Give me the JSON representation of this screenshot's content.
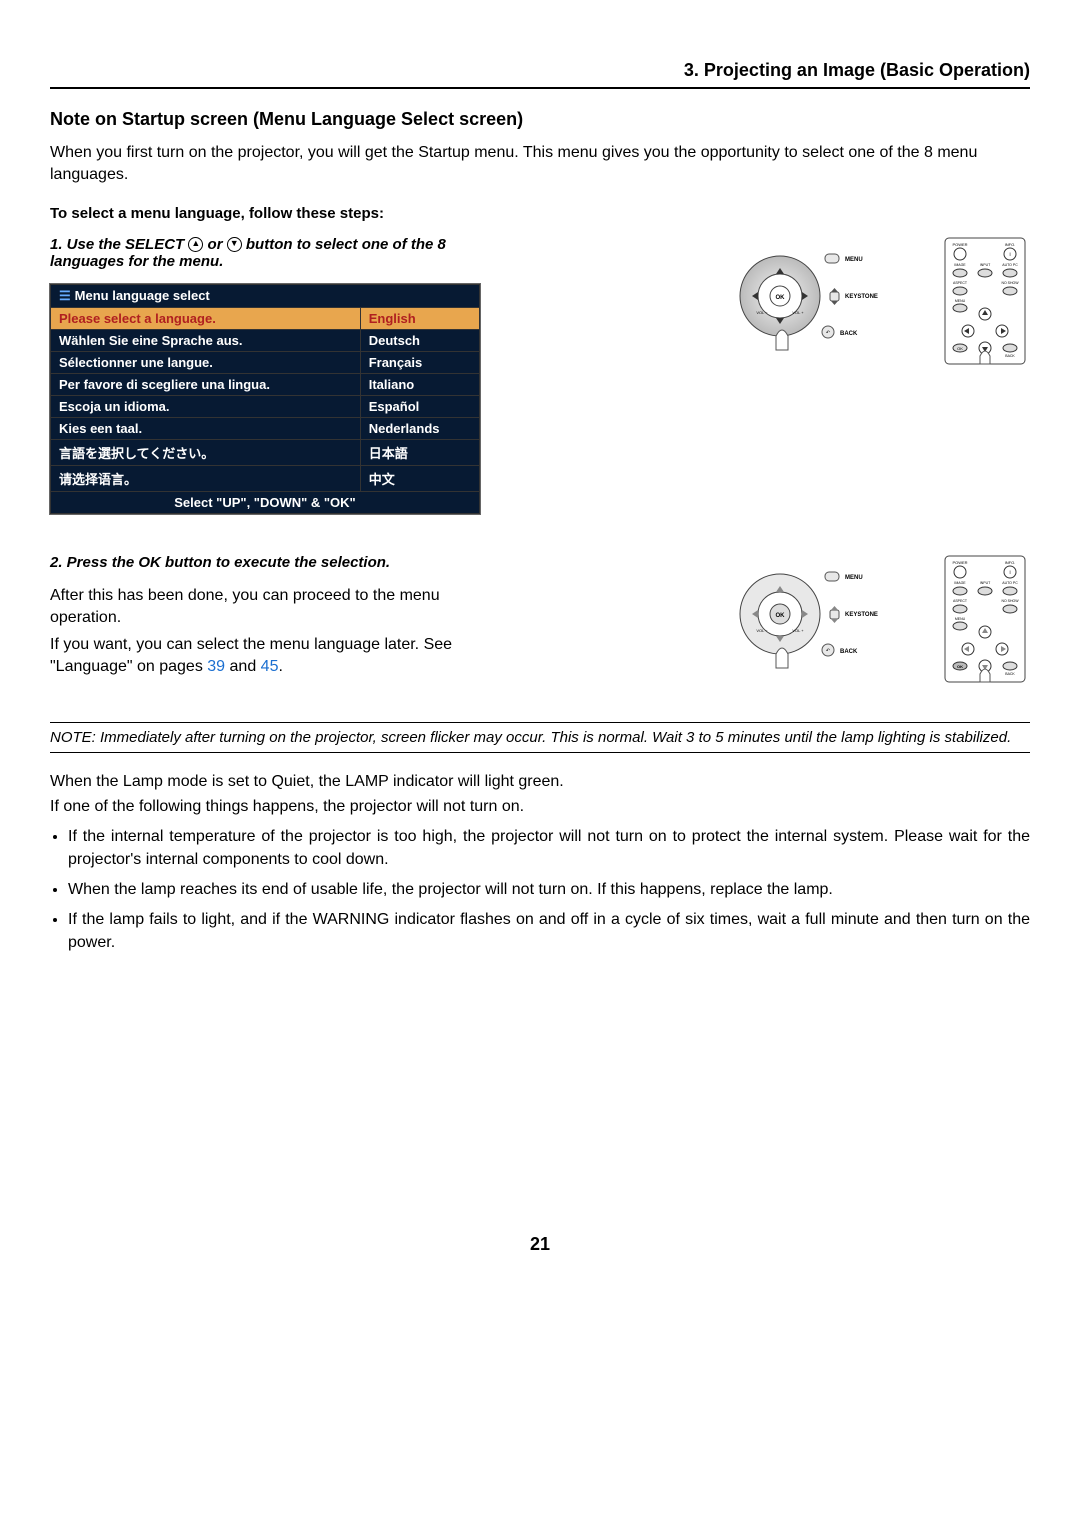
{
  "chapter": "3. Projecting an Image (Basic Operation)",
  "section_title": "Note on Startup screen (Menu Language Select screen)",
  "intro_text": "When you first turn on the projector, you will get the Startup menu. This menu gives you the opportunity to select one of the 8 menu languages.",
  "follow_steps_heading": "To select a menu language, follow these steps:",
  "step1_prefix": "1.  Use the SELECT ",
  "step1_mid": " or ",
  "step1_suffix": " button to select one of the 8 languages for the menu.",
  "menu": {
    "title": "Menu language select",
    "rows": [
      {
        "prompt": "Please select a language.",
        "lang": "English",
        "selected": true
      },
      {
        "prompt": "Wählen Sie eine Sprache aus.",
        "lang": "Deutsch",
        "selected": false
      },
      {
        "prompt": "Sélectionner une langue.",
        "lang": "Français",
        "selected": false
      },
      {
        "prompt": "Per favore di scegliere una lingua.",
        "lang": "Italiano",
        "selected": false
      },
      {
        "prompt": "Escoja un idioma.",
        "lang": "Español",
        "selected": false
      },
      {
        "prompt": "Kies een taal.",
        "lang": "Nederlands",
        "selected": false
      },
      {
        "prompt": "言語を選択してください。",
        "lang": "日本語",
        "selected": false
      },
      {
        "prompt": "请选择语言。",
        "lang": "中文",
        "selected": false
      }
    ],
    "footer": "Select \"UP\", \"DOWN\" & \"OK\""
  },
  "step2": "2.  Press the OK button to execute the selection.",
  "after_text": "After this has been done, you can proceed to the menu operation.",
  "later_text_a": "If you want, you can select the menu language later. See \"Language\" on pages ",
  "later_link1": "39",
  "later_text_mid": " and ",
  "later_link2": "45",
  "later_text_end": ".",
  "note_block": "NOTE: Immediately after turning on the projector, screen flicker may occur. This is normal. Wait 3 to 5 minutes until the lamp lighting is stabilized.",
  "lamp_quiet": "When the Lamp mode is set to Quiet, the LAMP indicator will light green.",
  "not_turn_on": "If one of the following things happens, the projector will not turn on.",
  "bullets": [
    "If the internal temperature of the projector is too high, the projector will not turn on to protect the internal system. Please wait for the projector's internal components to cool down.",
    "When the lamp reaches its end of usable life, the projector will not turn on. If this happens, replace the lamp.",
    "If the lamp fails to light, and if the WARNING indicator flashes on and off in a cycle of six times, wait a full minute and then turn on the power."
  ],
  "page_number": "21",
  "diagram_labels": {
    "menu": "MENU",
    "keystone": "KEYSTONE",
    "back": "BACK",
    "ok": "OK",
    "vol_minus": "VOL\n−",
    "vol_plus": "VOL\n+",
    "power": "POWER",
    "info": "INFO.",
    "image": "IMAGE",
    "input": "INPUT",
    "autopc": "AUTO PC",
    "aspect": "ASPECT",
    "noshow": "NO SHOW"
  }
}
